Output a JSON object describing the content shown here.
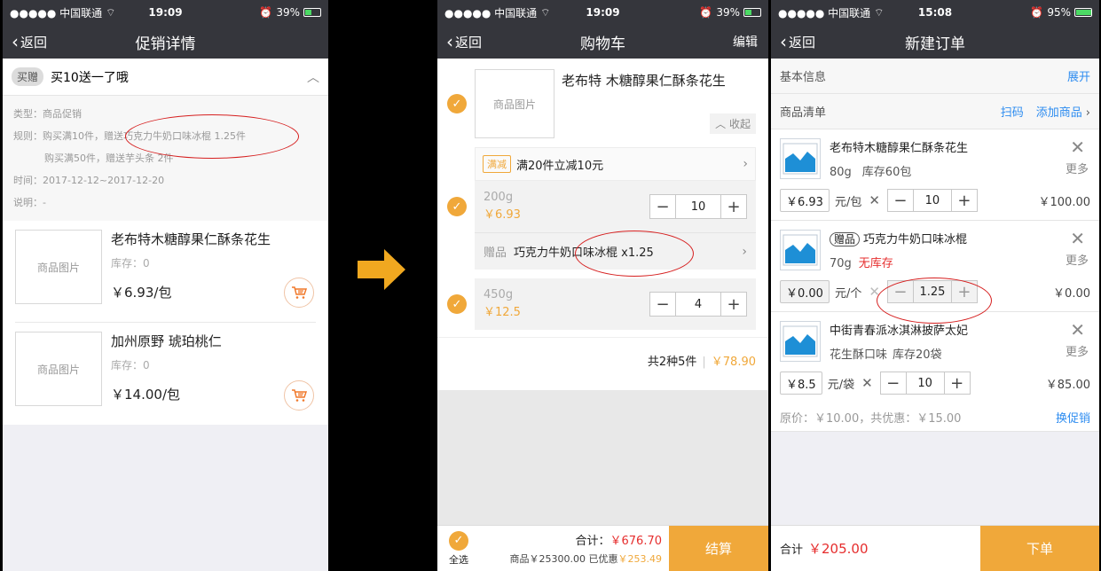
{
  "phone1": {
    "status": {
      "carrier": "●●●●● 中国联通",
      "time": "19:09",
      "battery": "39%",
      "battery_level": 0.39
    },
    "nav": {
      "back": "返回",
      "title": "促销详情"
    },
    "promo": {
      "badge": "买赠",
      "title": "买10送一了哦"
    },
    "info": {
      "type": "类型：商品促销",
      "rule1": "规则：购买满10件，赠送巧克力牛奶口味冰棍 1.25件",
      "rule2": "购买满50件，赠送芋头条 2件",
      "time": "时间：2017-12-12~2017-12-20",
      "note": "说明：-"
    },
    "products": [
      {
        "img": "商品图片",
        "name": "老布特木糖醇果仁酥条花生",
        "stock": "库存：0",
        "price": "￥6.93/包"
      },
      {
        "img": "商品图片",
        "name": "加州原野 琥珀桃仁",
        "stock": "库存：0",
        "price": "￥14.00/包"
      }
    ]
  },
  "phone2": {
    "status": {
      "carrier": "●●●●● 中国联通",
      "time": "19:09",
      "battery": "39%",
      "battery_level": 0.39
    },
    "nav": {
      "back": "返回",
      "title": "购物车",
      "edit": "编辑"
    },
    "product": {
      "img": "商品图片",
      "name": "老布特 木糖醇果仁酥条花生",
      "collapse": "收起"
    },
    "promo": {
      "tag": "满减",
      "text": "满20件立减10元"
    },
    "sku1": {
      "spec": "200g",
      "price": "￥6.93",
      "qty": "10"
    },
    "gift": {
      "label": "赠品",
      "name": "巧克力牛奶口味冰棍 x1.25"
    },
    "sku2": {
      "spec": "450g",
      "price": "￥12.5",
      "qty": "4"
    },
    "summary": {
      "count": "共2种5件",
      "amount": "￥78.90"
    },
    "footer": {
      "select_all": "全选",
      "total_label": "合计：",
      "total": "￥676.70",
      "goods_label": "商品￥25300.00 已优惠",
      "discount": "￥253.49",
      "pay": "结算"
    }
  },
  "phone3": {
    "status": {
      "carrier": "●●●●● 中国联通",
      "time": "15:08",
      "battery": "95%",
      "battery_level": 0.95
    },
    "nav": {
      "back": "返回",
      "title": "新建订单"
    },
    "basic": {
      "label": "基本信息",
      "expand": "展开"
    },
    "list_header": {
      "label": "商品清单",
      "scan": "扫码",
      "add": "添加商品"
    },
    "items": [
      {
        "name": "老布特木糖醇果仁酥条花生",
        "spec": "80g",
        "stock": "库存60包",
        "more": "更多",
        "unit_price": "￥6.93",
        "unit": "元/包",
        "qty": "10",
        "line": "￥100.00"
      },
      {
        "gift_tag": "赠品",
        "name": "巧克力牛奶口味冰棍",
        "spec": "70g",
        "stock": "无库存",
        "more": "更多",
        "unit_price": "￥0.00",
        "unit": "元/个",
        "qty": "1.25",
        "line": "￥0.00"
      },
      {
        "name": "中街青春派冰淇淋披萨太妃",
        "spec": "花生酥口味",
        "stock": "库存20袋",
        "more": "更多",
        "unit_price": "￥8.5",
        "unit": "元/袋",
        "qty": "10",
        "line": "￥85.00"
      }
    ],
    "orig": {
      "text": "原价：￥10.00，共优惠：￥15.00",
      "switch": "换促销"
    },
    "footer": {
      "total_label": "合计",
      "total": "￥205.00",
      "submit": "下单"
    }
  },
  "colors": {
    "accent": "#f0a83a",
    "nav": "#35363c",
    "price_red": "#e62e2e",
    "link_blue": "#2d8cf0",
    "annotation": "#d62020"
  },
  "icons": [
    "back-chevron-icon",
    "cart-icon",
    "check-icon",
    "close-icon",
    "image-placeholder-icon",
    "right-arrow-icon"
  ]
}
